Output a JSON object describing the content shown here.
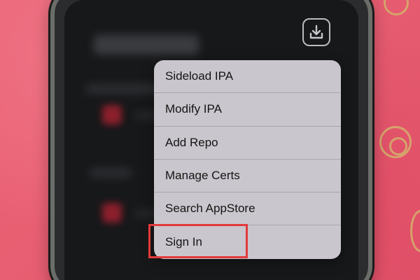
{
  "header": {
    "download_icon": "download-tray-icon"
  },
  "menu": {
    "items": [
      {
        "label": "Sideload IPA"
      },
      {
        "label": "Modify IPA"
      },
      {
        "label": "Add Repo"
      },
      {
        "label": "Manage Certs"
      },
      {
        "label": "Search AppStore"
      },
      {
        "label": "Sign In"
      }
    ]
  },
  "colors": {
    "background": "#e85d70",
    "menu_bg": "#cac6cd",
    "highlight": "#e23a3a"
  }
}
